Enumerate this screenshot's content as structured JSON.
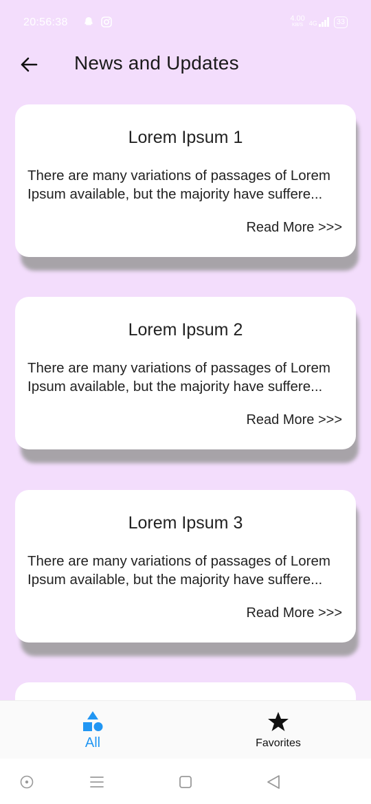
{
  "status_bar": {
    "time": "20:56:38",
    "speed_value": "4.00",
    "speed_unit": "KB/S",
    "network": "4G",
    "battery": "33"
  },
  "appbar": {
    "back_icon": "arrow-left-icon",
    "title": "News and Updates"
  },
  "news": [
    {
      "title": "Lorem Ipsum 1",
      "body": "There are many variations of passages of Lorem Ipsum available, but the majority have suffere...",
      "read_more": "Read More >>>"
    },
    {
      "title": "Lorem Ipsum 2",
      "body": "There are many variations of passages of Lorem Ipsum available, but the majority have suffere...",
      "read_more": "Read More >>>"
    },
    {
      "title": "Lorem Ipsum 3",
      "body": "There are many variations of passages of Lorem Ipsum available, but the majority have suffere...",
      "read_more": "Read More >>>"
    }
  ],
  "bottom_nav": {
    "all_label": "All",
    "all_icon": "shapes-icon",
    "favorites_label": "Favorites",
    "favorites_icon": "star-icon",
    "active_color": "#2196F3"
  },
  "colors": {
    "background": "#F3DDFC",
    "card": "#FFFFFF"
  }
}
